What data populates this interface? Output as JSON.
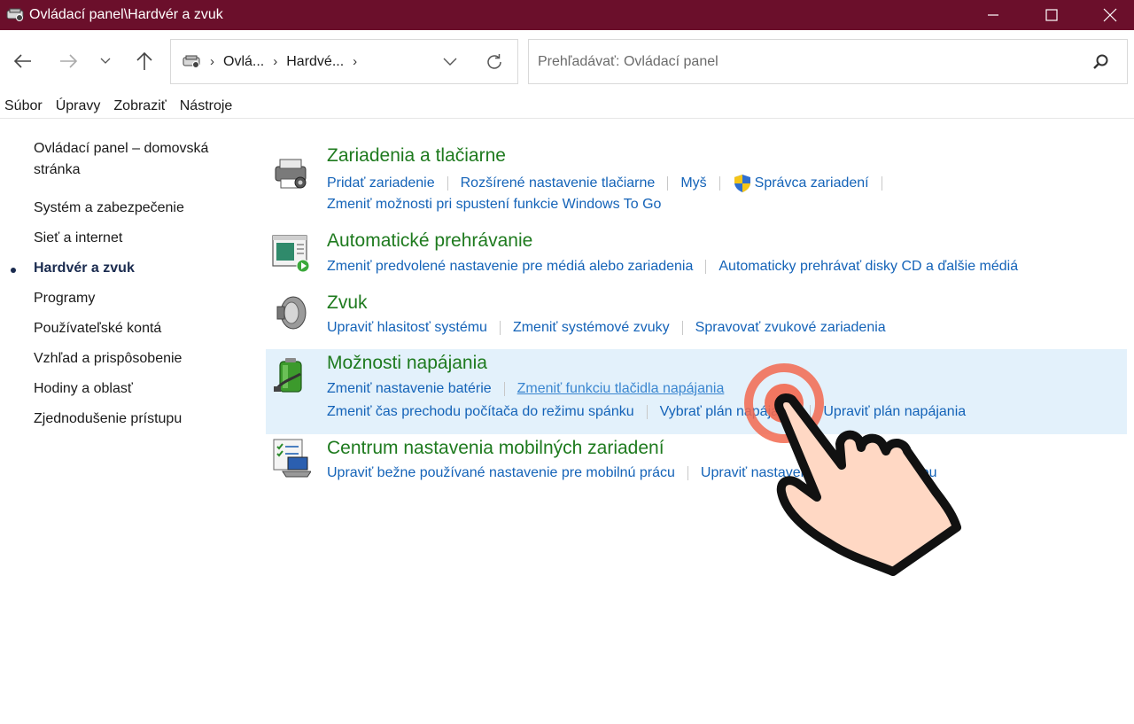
{
  "window": {
    "title": "Ovládací panel\\Hardvér a zvuk",
    "accent": "#6b0f2b"
  },
  "address": {
    "crumbs": [
      "Ovlá...",
      "Hardvé..."
    ]
  },
  "search": {
    "placeholder": "Prehľadávať: Ovládací panel"
  },
  "menu": [
    "Súbor",
    "Úpravy",
    "Zobraziť",
    "Nástroje"
  ],
  "leftnav": {
    "home": "Ovládací panel – domovská stránka",
    "items": [
      "Systém a zabezpečenie",
      "Sieť a internet",
      "Hardvér a zvuk",
      "Programy",
      "Používateľské kontá",
      "Vzhľad a prispôsobenie",
      "Hodiny a oblasť",
      "Zjednodušenie prístupu"
    ],
    "current": "Hardvér a zvuk"
  },
  "sections": [
    {
      "title": "Zariadenia a tlačiarne",
      "icon": "printer-icon",
      "links": [
        [
          "Pridať zariadenie",
          "Rozšírené nastavenie tlačiarne",
          "Myš",
          "Správca zariadení"
        ],
        [
          "Zmeniť možnosti pri spustení funkcie Windows To Go"
        ]
      ]
    },
    {
      "title": "Automatické prehrávanie",
      "icon": "autoplay-icon",
      "links": [
        [
          "Zmeniť predvolené nastavenie pre médiá alebo zariadenia",
          "Automaticky prehrávať disky CD a ďalšie médiá"
        ]
      ]
    },
    {
      "title": "Zvuk",
      "icon": "speaker-icon",
      "links": [
        [
          "Upraviť hlasitosť systému",
          "Zmeniť systémové zvuky",
          "Spravovať zvukové zariadenia"
        ]
      ]
    },
    {
      "title": "Možnosti napájania",
      "icon": "battery-icon",
      "links": [
        [
          "Zmeniť nastavenie batérie",
          "Zmeniť funkciu tlačidla napájania"
        ],
        [
          "Zmeniť čas prechodu počítača do režimu spánku",
          "Vybrať plán napájania",
          "Upraviť plán napájania"
        ]
      ]
    },
    {
      "title": "Centrum nastavenia mobilných zariadení",
      "icon": "mobility-center-icon",
      "links": [
        [
          "Upraviť bežne používané nastavenie pre mobilnú prácu",
          "Upraviť nastavenie pred prezentáciou"
        ]
      ]
    }
  ],
  "colors": {
    "section_title": "#1e7a1e",
    "link": "#1463b8",
    "highlight_bg": "#e3f1fb",
    "cursor_ring": "#f2684f",
    "cursor_hand": "#ffd8c4"
  }
}
